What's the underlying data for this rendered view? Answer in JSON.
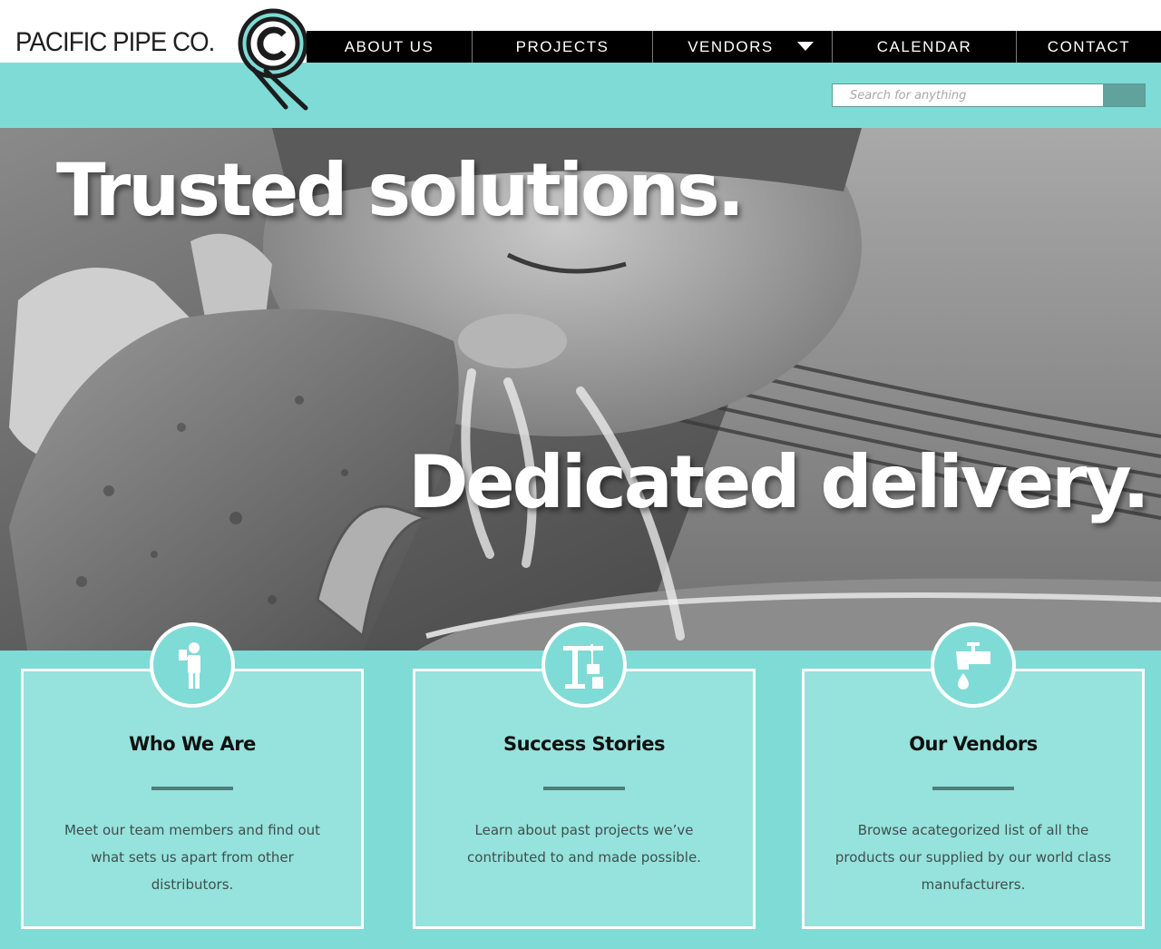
{
  "header": {
    "brand": "PACIFIC PIPE CO.",
    "logo_icon": "pacific-pipe-logo-mark",
    "colors": {
      "teal": "#7fdbd6",
      "dark": "#000000",
      "accent": "#5fa39c"
    }
  },
  "nav": {
    "items": [
      {
        "label": "ABOUT US"
      },
      {
        "label": "PROJECTS"
      },
      {
        "label": "VENDORS",
        "has_dropdown": true
      },
      {
        "label": "CALENDAR"
      },
      {
        "label": "CONTACT"
      }
    ]
  },
  "search": {
    "placeholder": "Search for anything",
    "value": ""
  },
  "hero": {
    "line_1": "Trusted solutions.",
    "line_2": "Dedicated delivery.",
    "image": "black-and-white photo of a child drinking from a stone water fountain"
  },
  "features": [
    {
      "icon": "businessman-icon",
      "title": "Who We Are",
      "text": "Meet our team members and find out what sets us apart from other distributors."
    },
    {
      "icon": "construction-crane-icon",
      "title": "Success Stories",
      "text": "Learn about past projects we’ve contributed to and made possible."
    },
    {
      "icon": "water-faucet-icon",
      "title": "Our Vendors",
      "text": "Browse acategorized list of all the products our supplied by our world class manufacturers."
    }
  ]
}
